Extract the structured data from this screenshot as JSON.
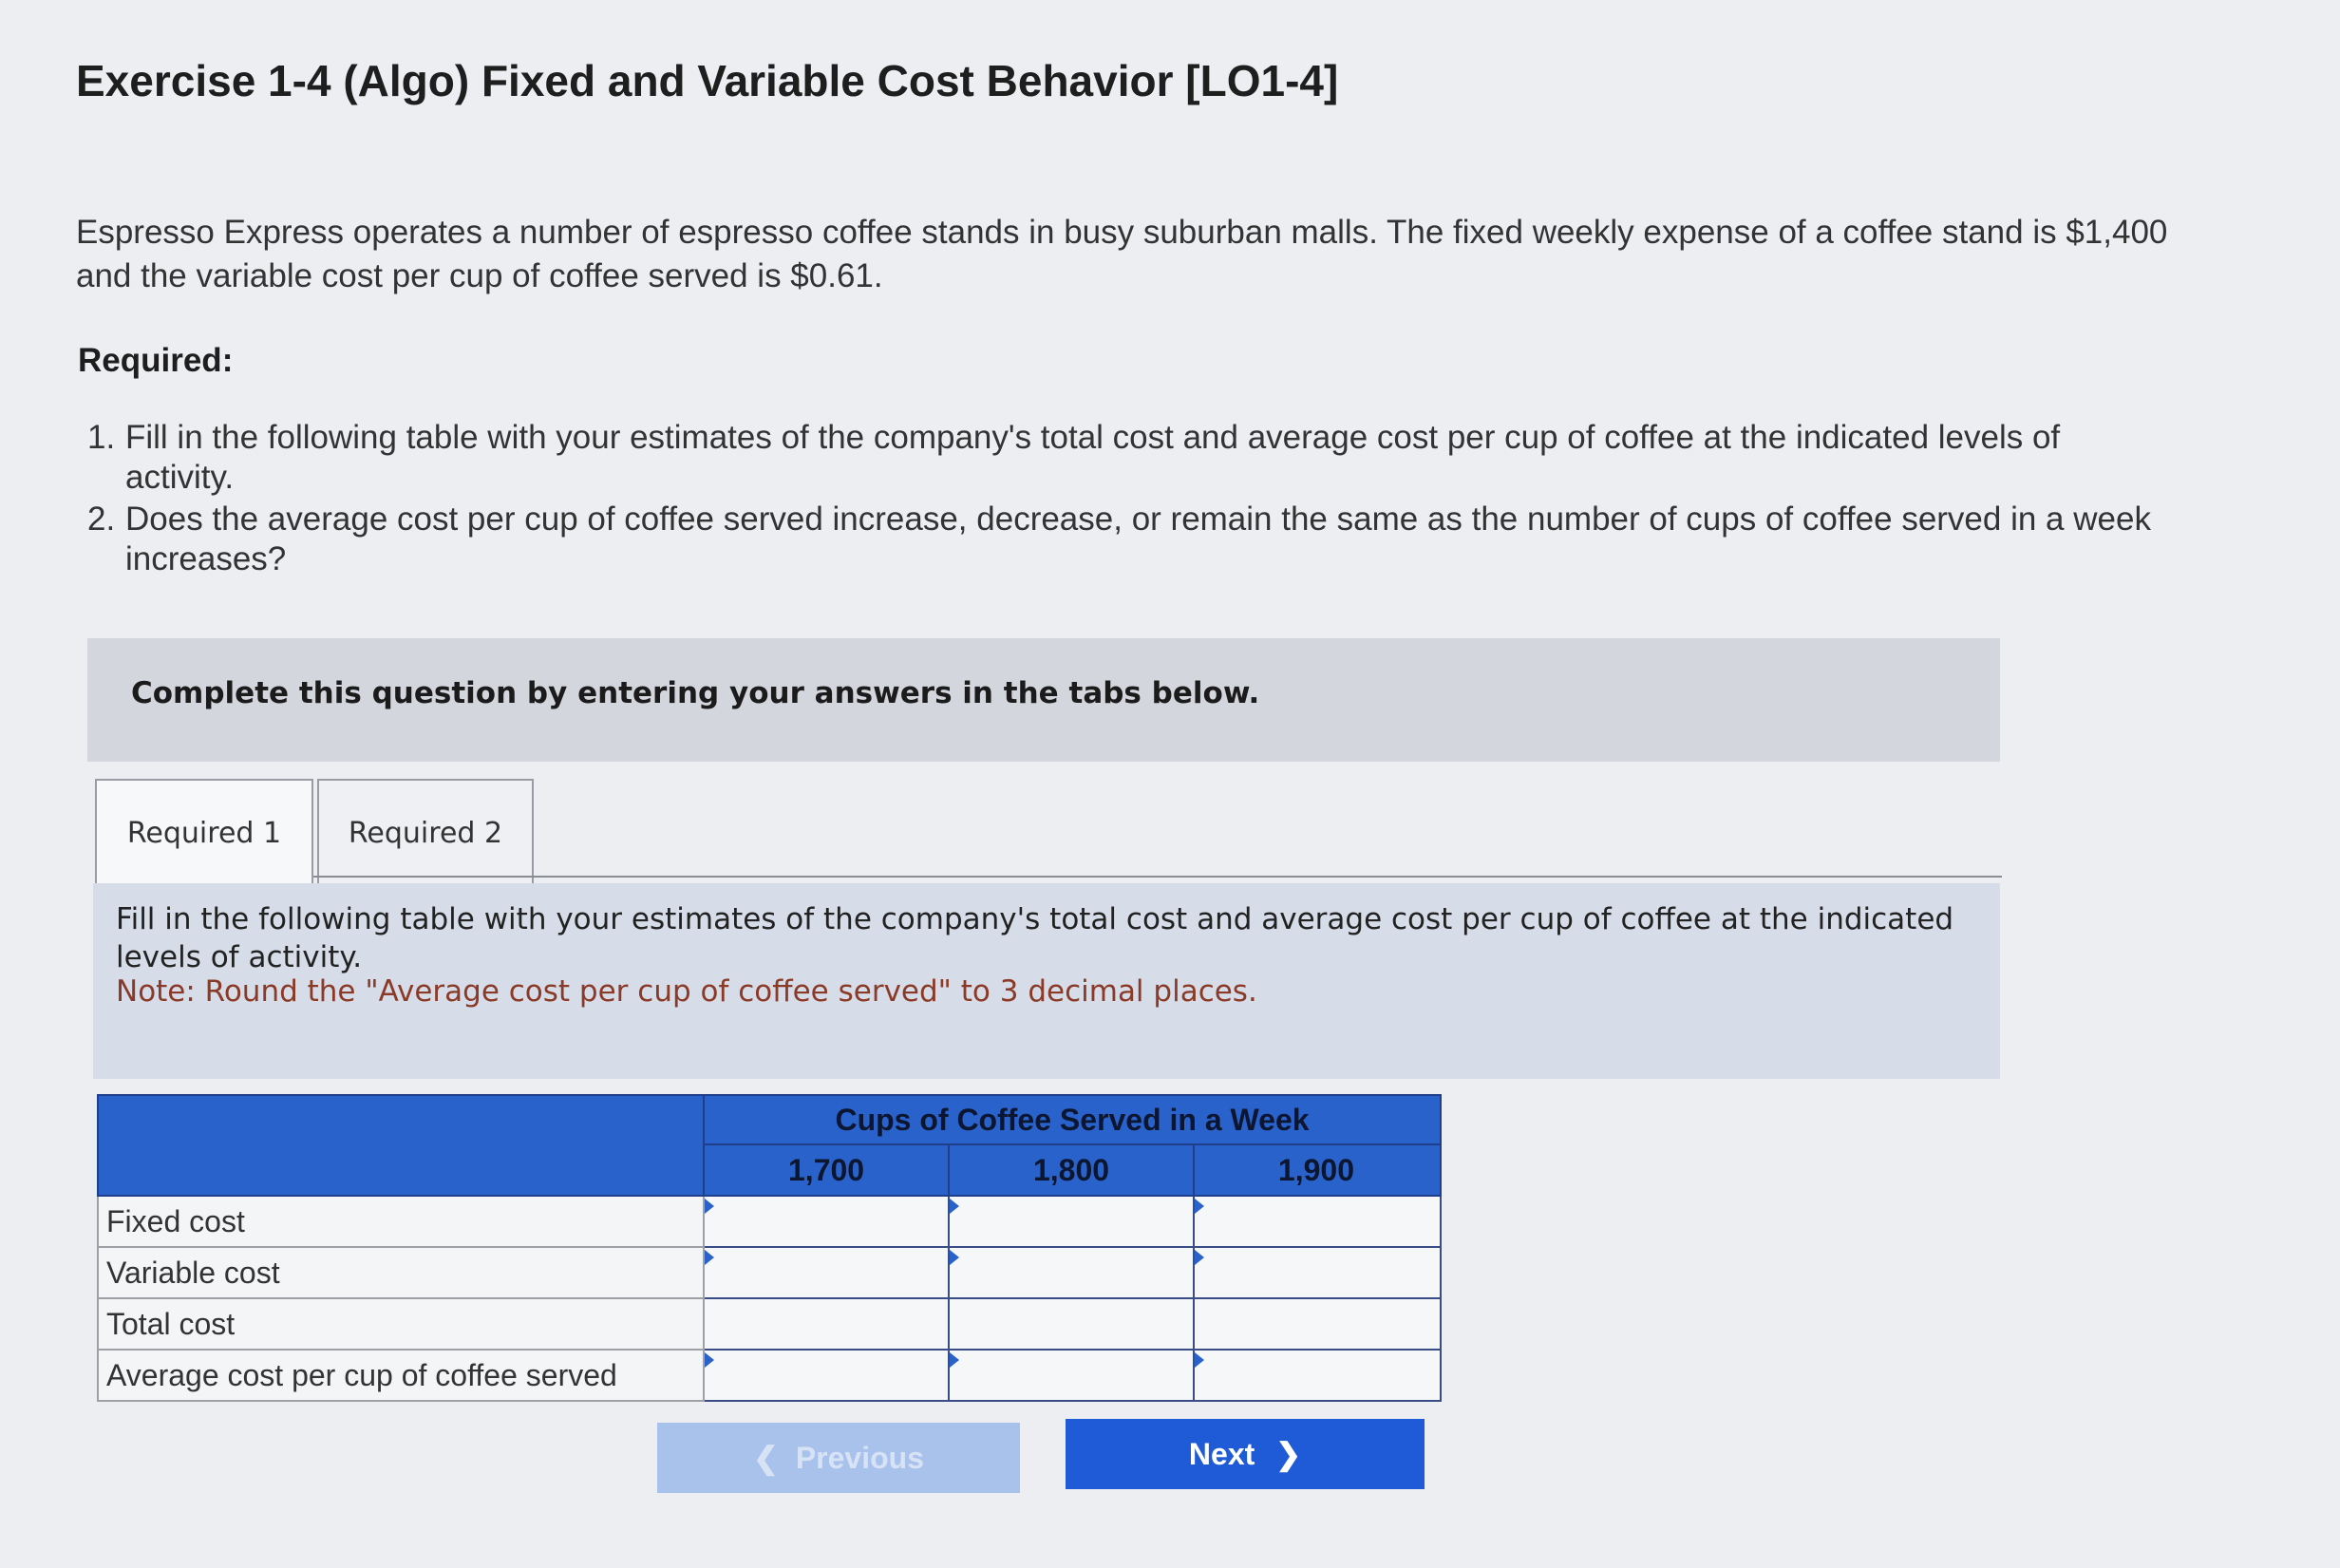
{
  "title": "Exercise 1-4 (Algo) Fixed and Variable Cost Behavior [LO1-4]",
  "intro": "Espresso Express operates a number of espresso coffee stands in busy suburban malls. The fixed weekly expense of a coffee stand is $1,400 and the variable cost per cup of coffee served is $0.61.",
  "required_label": "Required:",
  "requirements": [
    {
      "num": "1.",
      "text": "Fill in the following table with your estimates of the company's total cost and average cost per cup of coffee at the indicated levels of activity."
    },
    {
      "num": "2.",
      "text": "Does the average cost per cup of coffee served increase, decrease, or remain the same as the number of cups of coffee served in a week increases?"
    }
  ],
  "banner": "Complete this question by entering your answers in the tabs below.",
  "tabs": [
    "Required 1",
    "Required 2"
  ],
  "instructions": "Fill in the following table with your estimates of the company's total cost and average cost per cup of coffee at the indicated levels of activity.",
  "note": "Note: Round the \"Average cost per cup of coffee served\" to 3 decimal places.",
  "table": {
    "group_header": "Cups of Coffee Served in a Week",
    "columns": [
      "1,700",
      "1,800",
      "1,900"
    ],
    "rows": [
      "Fixed cost",
      "Variable cost",
      "Total cost",
      "Average cost per cup of coffee served"
    ]
  },
  "buttons": {
    "prev_icon": "chevron-left-icon",
    "prev": "Previous",
    "next": "Next",
    "next_icon": "chevron-right-icon"
  },
  "colors": {
    "accent": "#1f5bd6",
    "table_header": "#2a62cc",
    "note": "#8a3a26"
  }
}
